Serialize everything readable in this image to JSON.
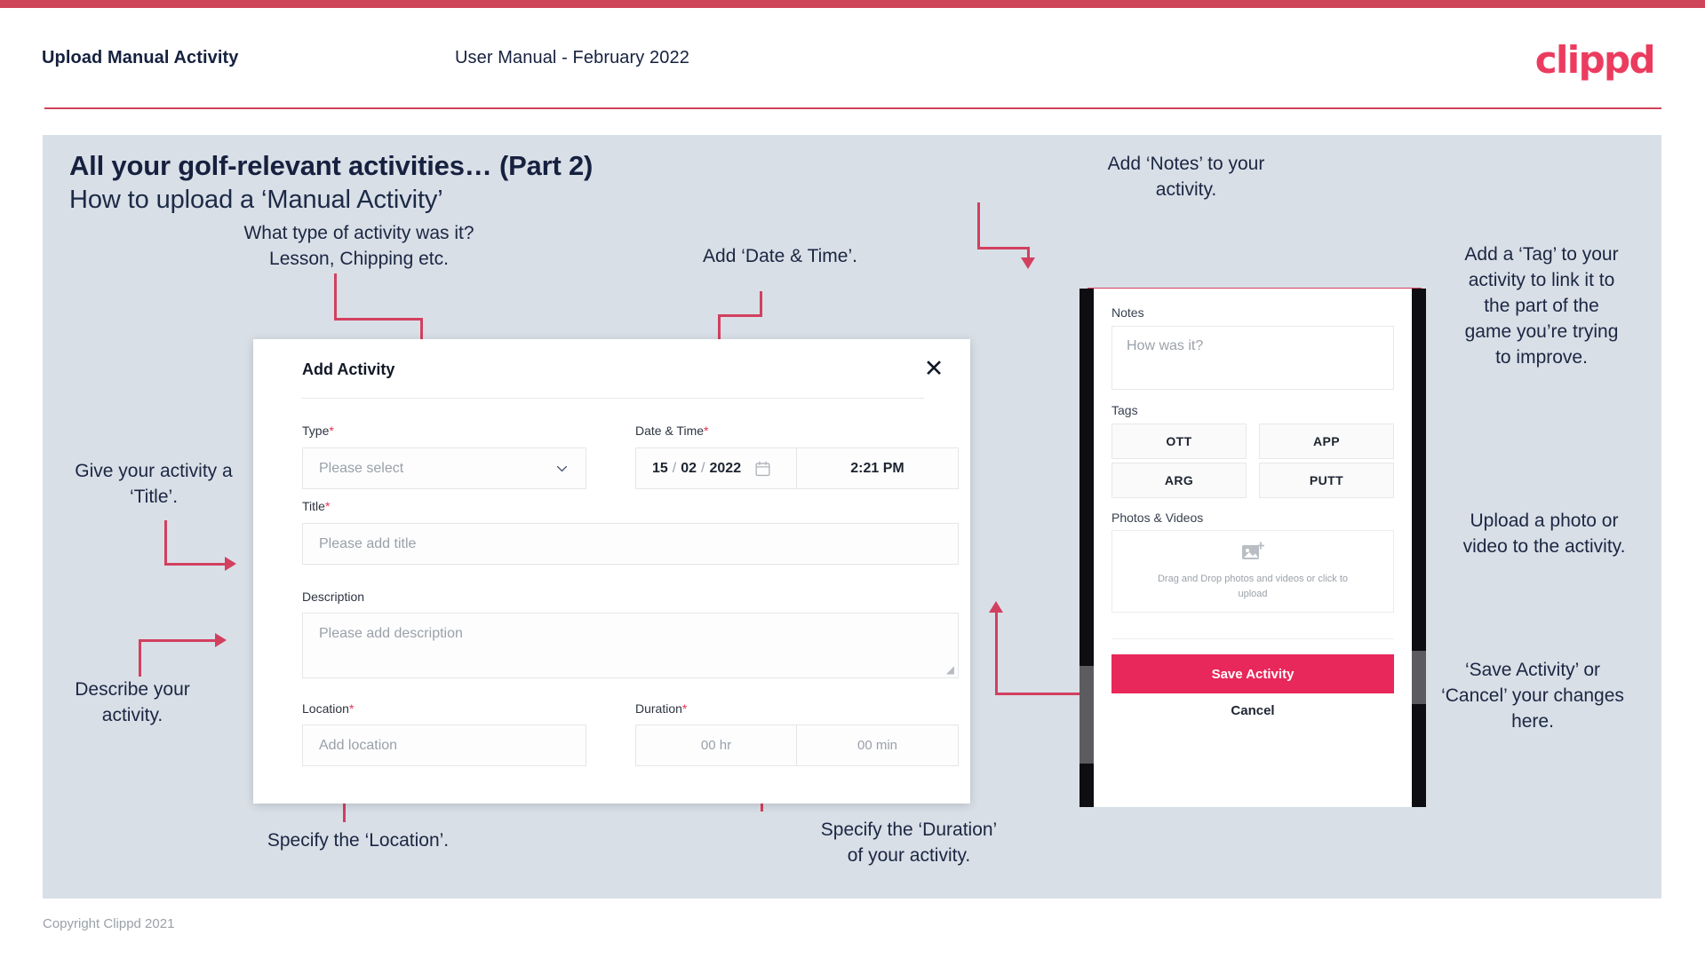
{
  "header": {
    "title": "Upload Manual Activity",
    "subtitle": "User Manual - February 2022",
    "brand": "clippd"
  },
  "slide": {
    "title": "All your golf-relevant activities… (Part 2)",
    "subtitle": "How to upload a ‘Manual Activity’"
  },
  "callouts": {
    "type": "What type of activity was it?\nLesson, Chipping etc.",
    "datetime": "Add ‘Date & Time’.",
    "title": "Give your activity a\n‘Title’.",
    "description": "Describe your\nactivity.",
    "location": "Specify the ‘Location’.",
    "duration": "Specify the ‘Duration’\nof your activity.",
    "notes": "Add ‘Notes’ to your\nactivity.",
    "tags": "Add a ‘Tag’ to your\nactivity to link it to\nthe part of the\ngame you’re trying\nto improve.",
    "photos": "Upload a photo or\nvideo to the activity.",
    "save": "‘Save Activity’ or\n‘Cancel’ your changes\nhere."
  },
  "dialog": {
    "title": "Add Activity",
    "close_label": "✕",
    "fields": {
      "type": {
        "label": "Type",
        "required": "*",
        "placeholder": "Please select"
      },
      "datetime": {
        "label": "Date & Time",
        "required": "*",
        "day": "15",
        "month": "02",
        "year": "2022",
        "separator": "/",
        "time": "2:21 PM"
      },
      "title": {
        "label": "Title",
        "required": "*",
        "placeholder": "Please add title"
      },
      "description": {
        "label": "Description",
        "required": "",
        "placeholder": "Please add description"
      },
      "location": {
        "label": "Location",
        "required": "*",
        "placeholder": "Add location"
      },
      "duration": {
        "label": "Duration",
        "required": "*",
        "hours_placeholder": "00 hr",
        "minutes_placeholder": "00 min"
      }
    }
  },
  "phone": {
    "notes": {
      "label": "Notes",
      "placeholder": "How was it?"
    },
    "tags": {
      "label": "Tags",
      "items": [
        "OTT",
        "APP",
        "ARG",
        "PUTT"
      ]
    },
    "photos": {
      "label": "Photos & Videos",
      "drop_text": "Drag and Drop photos and videos or click to upload"
    },
    "save_label": "Save Activity",
    "cancel_label": "Cancel"
  },
  "footer": {
    "copyright": "Copyright Clippd 2021"
  },
  "colors": {
    "brand_pink": "#e8275a",
    "accent_crimson": "#cf4459",
    "arrow": "#d2405f",
    "slide_bg": "#d9dfe7",
    "text_dark": "#16213f"
  }
}
